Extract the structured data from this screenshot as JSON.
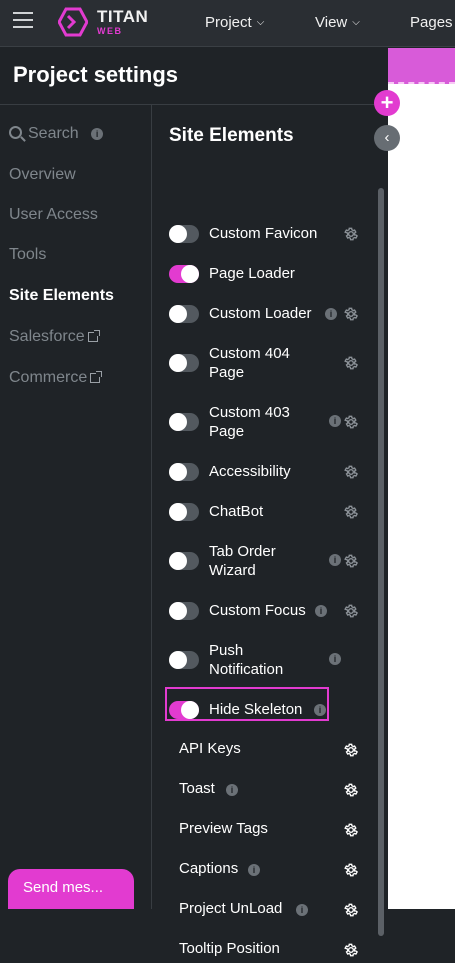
{
  "topbar": {
    "brand": "TITAN",
    "brand_sub": "WEB",
    "nav": [
      {
        "label": "Project"
      },
      {
        "label": "View"
      },
      {
        "label": "Pages"
      }
    ]
  },
  "panel": {
    "title": "Project settings"
  },
  "sidebar": {
    "search_label": "Search",
    "items": [
      {
        "label": "Overview"
      },
      {
        "label": "User Access"
      },
      {
        "label": "Tools"
      },
      {
        "label": "Site Elements"
      },
      {
        "label": "Salesforce"
      },
      {
        "label": "Commerce"
      }
    ]
  },
  "content": {
    "section_title": "Site Elements",
    "toggles": [
      {
        "label1": "Custom Favicon",
        "label2": "",
        "on": false,
        "info": false,
        "gear": true
      },
      {
        "label1": "Page Loader",
        "label2": "",
        "on": true,
        "info": false,
        "gear": false
      },
      {
        "label1": "Custom Loader",
        "label2": "",
        "on": false,
        "info": true,
        "gear": true
      },
      {
        "label1": "Custom 404",
        "label2": "Page",
        "on": false,
        "info": false,
        "gear": true
      },
      {
        "label1": "Custom 403",
        "label2": "Page",
        "on": false,
        "info": true,
        "gear": true
      },
      {
        "label1": "Accessibility",
        "label2": "",
        "on": false,
        "info": false,
        "gear": true
      },
      {
        "label1": "ChatBot",
        "label2": "",
        "on": false,
        "info": false,
        "gear": true
      },
      {
        "label1": "Tab Order",
        "label2": "Wizard",
        "on": false,
        "info": true,
        "gear": true
      },
      {
        "label1": "Custom Focus",
        "label2": "",
        "on": false,
        "info": true,
        "gear": true
      },
      {
        "label1": "Push",
        "label2": "Notification",
        "on": false,
        "info": true,
        "gear": false
      },
      {
        "label1": "Hide Skeleton",
        "label2": "",
        "on": true,
        "info": true,
        "gear": false
      }
    ],
    "plain_items": [
      {
        "label": "API Keys",
        "info": false
      },
      {
        "label": "Toast",
        "info": true
      },
      {
        "label": "Preview Tags",
        "info": false
      },
      {
        "label": "Captions",
        "info": true
      },
      {
        "label": "Project UnLoad",
        "info": true
      },
      {
        "label": "Tooltip Position",
        "info": false
      }
    ]
  },
  "chat": {
    "send_label": "Send mes..."
  },
  "colors": {
    "accent": "#e23bd0",
    "background": "#1f2327",
    "topbar": "#2a2e33"
  }
}
